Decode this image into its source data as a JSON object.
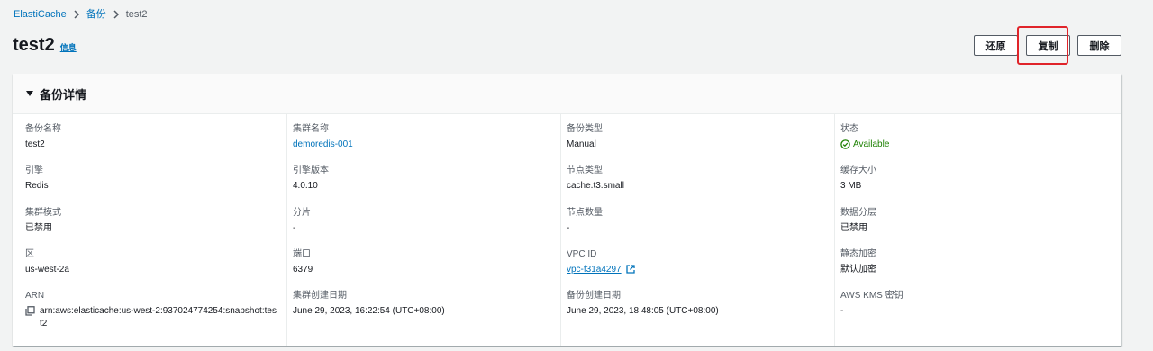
{
  "breadcrumb": {
    "items": [
      "ElastiCache",
      "备份"
    ],
    "current": "test2"
  },
  "header": {
    "title": "test2",
    "info_link": "信息"
  },
  "actions": {
    "restore": "还原",
    "copy": "复制",
    "delete": "删除"
  },
  "panel": {
    "title": "备份详情",
    "columns": [
      [
        {
          "label": "备份名称",
          "value": "test2"
        },
        {
          "label": "引擎",
          "value": "Redis"
        },
        {
          "label": "集群模式",
          "value": "已禁用"
        },
        {
          "label": "区",
          "value": "us-west-2a"
        },
        {
          "label": "ARN",
          "value": "arn:aws:elasticache:us-west-2:937024774254:snapshot:test2"
        }
      ],
      [
        {
          "label": "集群名称",
          "value": "demoredis-001"
        },
        {
          "label": "引擎版本",
          "value": "4.0.10"
        },
        {
          "label": "分片",
          "value": "-"
        },
        {
          "label": "端口",
          "value": "6379"
        },
        {
          "label": "集群创建日期",
          "value": "June 29, 2023, 16:22:54 (UTC+08:00)"
        }
      ],
      [
        {
          "label": "备份类型",
          "value": "Manual"
        },
        {
          "label": "节点类型",
          "value": "cache.t3.small"
        },
        {
          "label": "节点数量",
          "value": "-"
        },
        {
          "label": "VPC ID",
          "value": "vpc-f31a4297"
        },
        {
          "label": "备份创建日期",
          "value": "June 29, 2023, 18:48:05 (UTC+08:00)"
        }
      ],
      [
        {
          "label": "状态",
          "value": "Available"
        },
        {
          "label": "缓存大小",
          "value": "3 MB"
        },
        {
          "label": "数据分层",
          "value": "已禁用"
        },
        {
          "label": "静态加密",
          "value": "默认加密"
        },
        {
          "label": "AWS KMS 密钥",
          "value": "-"
        }
      ]
    ]
  },
  "colors": {
    "link": "#0073bb",
    "success": "#1d8102",
    "highlight": "#e0242a"
  }
}
